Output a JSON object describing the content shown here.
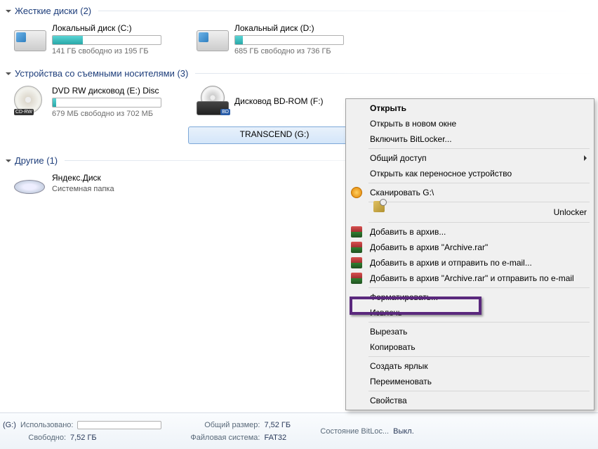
{
  "groups": {
    "hdd": {
      "title": "Жесткие диски",
      "count": "(2)"
    },
    "removable": {
      "title": "Устройства со съемными носителями",
      "count": "(3)"
    },
    "other": {
      "title": "Другие",
      "count": "(1)"
    }
  },
  "drives": {
    "c": {
      "title": "Локальный диск (C:)",
      "sub": "141 ГБ свободно из 195 ГБ",
      "fill_pct": 28
    },
    "d": {
      "title": "Локальный диск (D:)",
      "sub": "685 ГБ свободно из 736 ГБ",
      "fill_pct": 7
    },
    "e": {
      "title": "DVD RW дисковод (E:) Disc",
      "sub": "679 МБ свободно из 702 МБ",
      "fill_pct": 3,
      "badge": "CD-RW"
    },
    "bd": {
      "title": "Дисковод BD-ROM (F:)",
      "badge": "BD"
    },
    "g": {
      "title": "TRANSCEND (G:)"
    },
    "yandex": {
      "title": "Яндекс.Диск",
      "sub": "Системная папка"
    }
  },
  "menu": {
    "open": "Открыть",
    "open_new": "Открыть в новом окне",
    "bitlocker": "Включить BitLocker...",
    "share": "Общий доступ",
    "portable": "Открыть как переносное устройство",
    "scan": "Сканировать G:\\",
    "unlocker": "Unlocker",
    "archive_add": "Добавить в архив...",
    "archive_rar": "Добавить в архив \"Archive.rar\"",
    "archive_email": "Добавить в архив и отправить по e-mail...",
    "archive_rar_email": "Добавить в архив \"Archive.rar\" и отправить по e-mail",
    "format": "Форматировать...",
    "eject": "Извлечь",
    "cut": "Вырезать",
    "copy": "Копировать",
    "shortcut": "Создать ярлык",
    "rename": "Переименовать",
    "properties": "Свойства"
  },
  "status": {
    "drive_label": "(G:)",
    "used_label": "Использовано:",
    "free_label": "Свободно:",
    "free_val": "7,52 ГБ",
    "total_label": "Общий размер:",
    "total_val": "7,52 ГБ",
    "fs_label": "Файловая система:",
    "fs_val": "FAT32",
    "bitloc_label": "Состояние BitLoc...",
    "bitloc_val": "Выкл."
  }
}
